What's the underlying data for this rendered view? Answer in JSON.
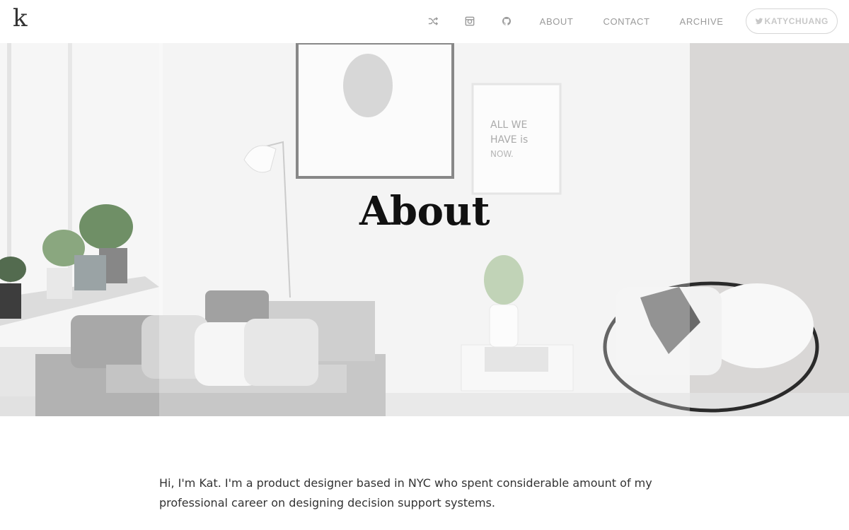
{
  "site": {
    "logo_text": "k"
  },
  "nav": {
    "icons": [
      "shuffle-icon",
      "instagram-icon",
      "github-icon"
    ],
    "links": [
      "ABOUT",
      "CONTACT",
      "ARCHIVE"
    ],
    "twitter_handle": "KATYCHUANG"
  },
  "hero": {
    "title": "About",
    "poster_text": [
      "ALL WE",
      "HAVE is",
      "NOW."
    ]
  },
  "content": {
    "intro": "Hi, I'm Kat. I'm a product designer based in NYC who spent considerable amount of my professional career on designing decision support systems."
  },
  "colors": {
    "nav_text": "#9a9a9a",
    "title": "#111111",
    "body_text": "#333333"
  }
}
